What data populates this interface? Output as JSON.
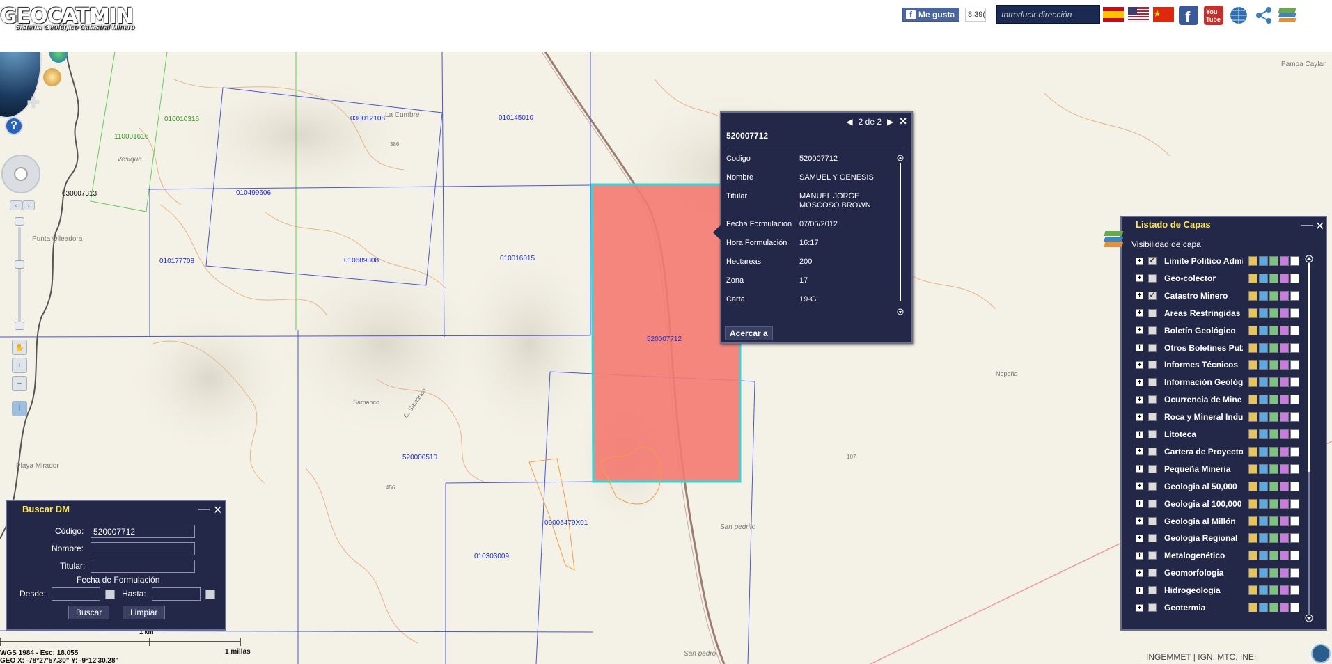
{
  "header": {
    "logo": "GEOCATMIN",
    "logo_sub": "Sistema Geológico Catastral Minero",
    "fb_like": "Me gusta",
    "fb_count": "8.39(",
    "address_placeholder": "Introducir dirección",
    "icons": [
      "flag-spain-icon",
      "flag-usa-icon",
      "flag-china-icon",
      "facebook-icon",
      "youtube-icon",
      "globe-grid-icon",
      "share-icon",
      "layers-stack-icon"
    ]
  },
  "map": {
    "claims": [
      {
        "code": "010010316",
        "color": "#3a9a2a"
      },
      {
        "code": "110001616",
        "color": "#3a9a2a"
      },
      {
        "code": "030012108"
      },
      {
        "code": "010145010"
      },
      {
        "code": "010499606"
      },
      {
        "code": "030007313"
      },
      {
        "code": "010177708"
      },
      {
        "code": "010689308"
      },
      {
        "code": "010016015"
      },
      {
        "code": "520007712"
      },
      {
        "code": "520000510"
      },
      {
        "code": "09005479X01"
      },
      {
        "code": "010303009"
      }
    ],
    "places": [
      "Pampa Caylan",
      "La Cumbre",
      "386",
      "Vesique",
      "Punta Olleadora",
      "Samanco",
      "C. Samanco",
      "456",
      "Playa Mirador",
      "Nepeña",
      "107",
      "San pedrito",
      "San pedro"
    ],
    "highlight_color": "#f07a72"
  },
  "popup": {
    "pager": "2 de 2",
    "title": "520007712",
    "rows": [
      {
        "k": "Codigo",
        "v": "520007712"
      },
      {
        "k": "Nombre",
        "v": "SAMUEL Y GENESIS"
      },
      {
        "k": "Titular",
        "v": "MANUEL JORGE MOSCOSO BROWN"
      },
      {
        "k": "Fecha Formulación",
        "v": "07/05/2012"
      },
      {
        "k": "Hora Formulación",
        "v": "16:17"
      },
      {
        "k": "Hectareas",
        "v": "200"
      },
      {
        "k": "Zona",
        "v": "17"
      },
      {
        "k": "Carta",
        "v": "19-G"
      }
    ],
    "zoom_button": "Acercar a"
  },
  "buscar": {
    "title": "Buscar DM",
    "codigo_label": "Código:",
    "codigo_value": "520007712",
    "nombre_label": "Nombre:",
    "nombre_value": "",
    "titular_label": "Titular:",
    "titular_value": "",
    "fecha_label": "Fecha de Formulación",
    "desde_label": "Desde:",
    "hasta_label": "Hasta:",
    "buscar_button": "Buscar",
    "limpiar_button": "Limpiar"
  },
  "layers": {
    "title": "Listado de Capas",
    "subtitle": "Visibilidad de capa",
    "items": [
      {
        "name": "Limite Politico Admi",
        "checked": true
      },
      {
        "name": "Geo-colector",
        "checked": false
      },
      {
        "name": "Catastro Minero",
        "checked": true
      },
      {
        "name": "Areas Restringidas",
        "checked": false
      },
      {
        "name": "Boletín Geológico",
        "checked": false
      },
      {
        "name": "Otros Boletines Pub",
        "checked": false
      },
      {
        "name": "Informes Técnicos",
        "checked": false
      },
      {
        "name": "Información Geológi",
        "checked": false
      },
      {
        "name": "Ocurrencia de Mine",
        "checked": false
      },
      {
        "name": "Roca y Mineral Indu",
        "checked": false
      },
      {
        "name": "Litoteca",
        "checked": false
      },
      {
        "name": "Cartera de Proyecto",
        "checked": false
      },
      {
        "name": "Pequeña Mineria",
        "checked": false
      },
      {
        "name": "Geologia al 50,000",
        "checked": false
      },
      {
        "name": "Geologia al 100,000",
        "checked": false
      },
      {
        "name": "Geologia al Millón",
        "checked": false
      },
      {
        "name": "Geologia Regional",
        "checked": false
      },
      {
        "name": "Metalogenético",
        "checked": false
      },
      {
        "name": "Geomorfologia",
        "checked": false
      },
      {
        "name": "Hidrogeologia",
        "checked": false
      },
      {
        "name": "Geotermia",
        "checked": false
      }
    ]
  },
  "status": {
    "scale_km": "1 km",
    "scale_mi": "1 millas",
    "line1": "WGS 1984 - Esc: 18.055",
    "line2": "GEO X: -78°27'57.30\" Y: -9°12'30.28\"",
    "credit": "INGEMMET | IGN, MTC, INEI"
  }
}
